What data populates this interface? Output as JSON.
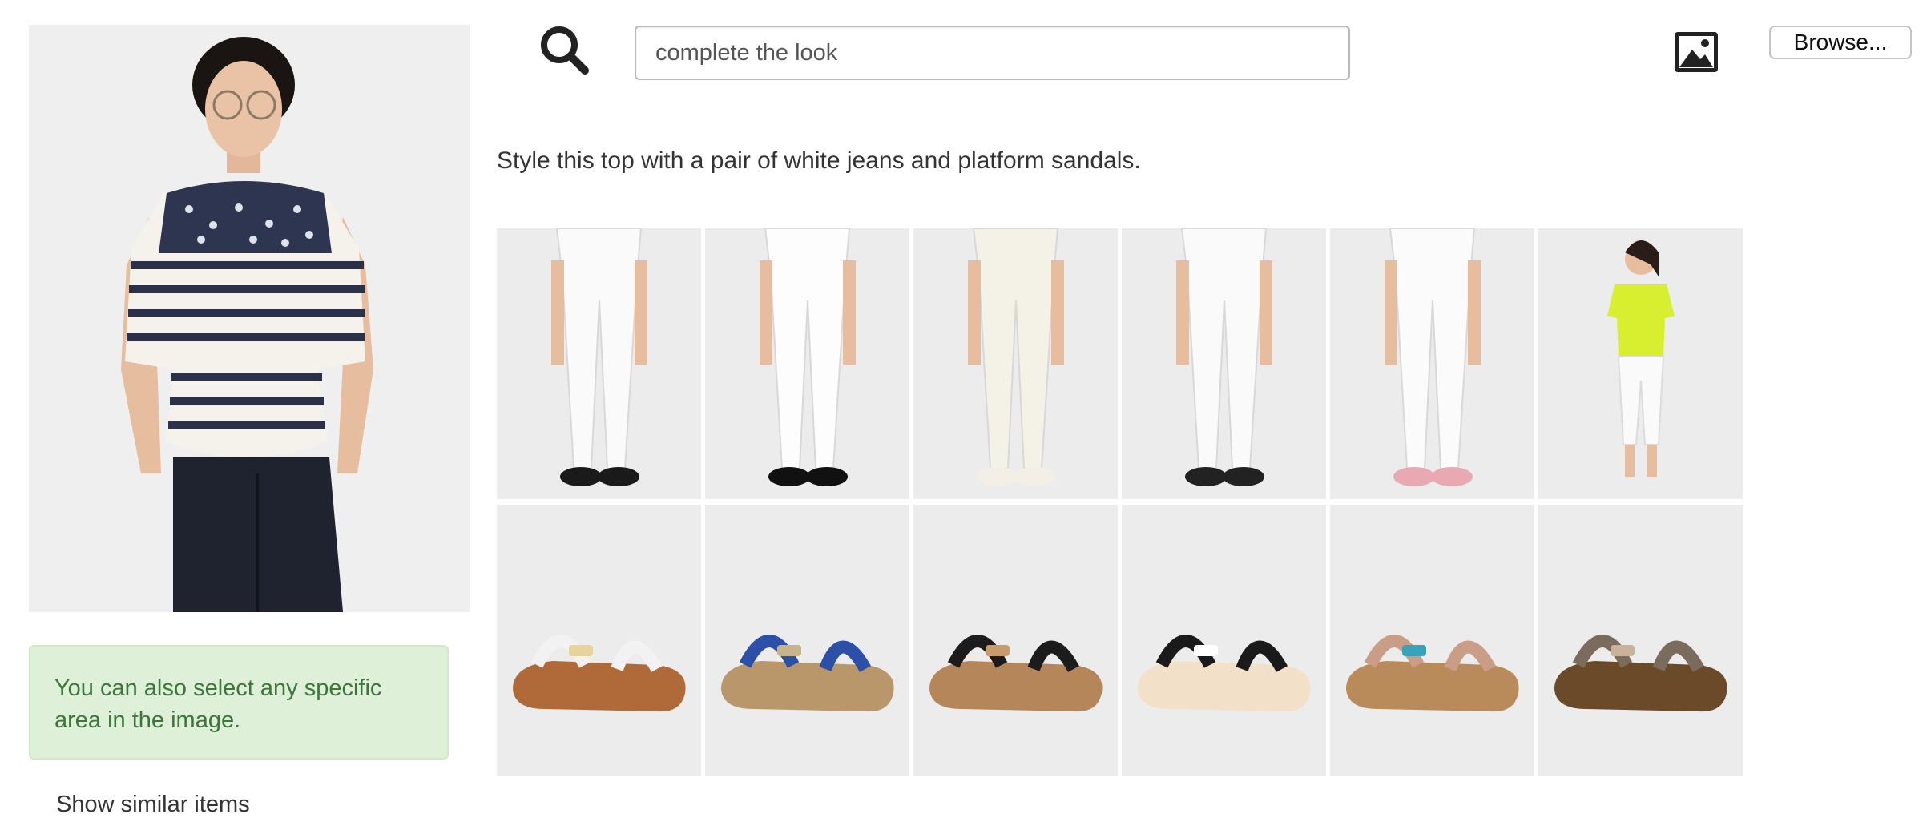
{
  "search": {
    "value": "complete the look",
    "icon": "search-icon"
  },
  "toolbar": {
    "image_icon": "image-icon",
    "browse_label": "Browse..."
  },
  "query": {
    "image_icon": "photo-model-striped-top",
    "hint": "You can also select any specific area in the image.",
    "below_hint_text": "Show similar items"
  },
  "results": {
    "suggestion": "Style this top with a pair of white jeans and platform sandals.",
    "tiles": [
      {
        "kind": "jeans",
        "footwear": "#1a1a1a",
        "jeans": "#fafafa"
      },
      {
        "kind": "jeans",
        "footwear": "#111111",
        "jeans": "#fdfdfd"
      },
      {
        "kind": "jeans",
        "footwear": "#f3efe6",
        "jeans": "#f4f1e6"
      },
      {
        "kind": "jeans",
        "footwear": "#222222",
        "jeans": "#fafafa"
      },
      {
        "kind": "jeans",
        "footwear": "#e8a9b2",
        "jeans": "#fbfbfb"
      },
      {
        "kind": "model",
        "top": "#d7ef2e",
        "jeans": "#fafafa"
      },
      {
        "kind": "sandal",
        "strap": "#f2f2f2",
        "sole": "#b06a3a",
        "accent": "#e8d49a"
      },
      {
        "kind": "sandal",
        "strap": "#2c4fa8",
        "sole": "#b9976b",
        "accent": "#c7b48a"
      },
      {
        "kind": "sandal",
        "strap": "#1c1c1c",
        "sole": "#b5865a",
        "accent": "#c79c6c"
      },
      {
        "kind": "sandal",
        "strap": "#1a1a1a",
        "sole": "#f2e1c8",
        "accent": "#ffffff"
      },
      {
        "kind": "sandal",
        "strap": "#c99d86",
        "sole": "#b98a5a",
        "accent": "#3aa3b8"
      },
      {
        "kind": "sandal",
        "strap": "#7a6b5c",
        "sole": "#6b4a2a",
        "accent": "#c9b19a"
      }
    ]
  },
  "colors": {
    "alert_bg": "#dff0d8",
    "alert_text": "#3c763d",
    "tile_bg": "#ececec"
  }
}
